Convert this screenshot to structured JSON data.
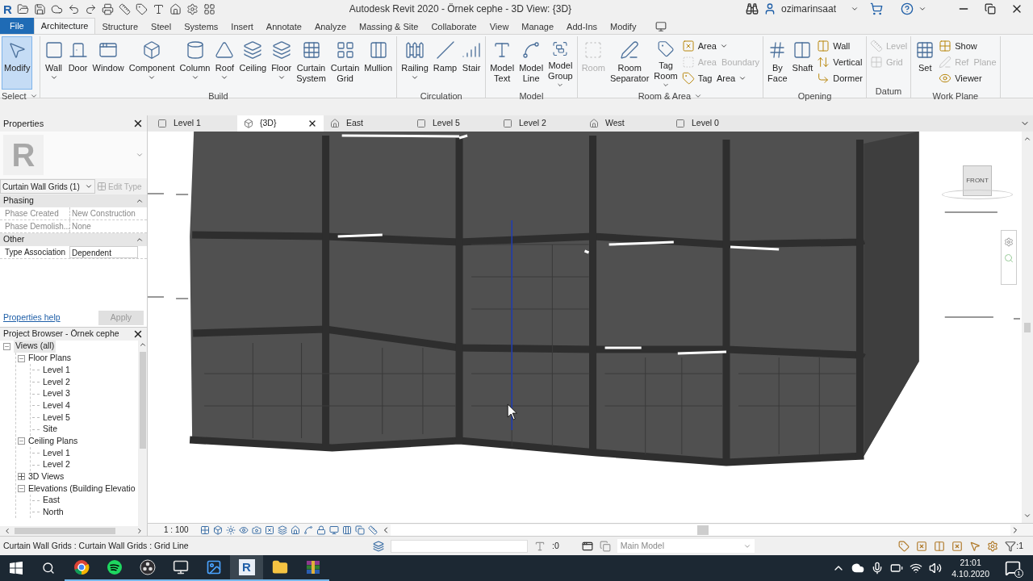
{
  "title_bar": {
    "logo": "R",
    "title": "Autodesk Revit 2020 - Örnek cephe - 3D View: {3D}",
    "user": "ozimarinsaat"
  },
  "ribbon_tabs": [
    {
      "label": "File",
      "kind": "file",
      "selected": false
    },
    {
      "label": "Architecture",
      "kind": "tab",
      "selected": true
    },
    {
      "label": "Structure",
      "kind": "tab",
      "selected": false
    },
    {
      "label": "Steel",
      "kind": "tab",
      "selected": false
    },
    {
      "label": "Systems",
      "kind": "tab",
      "selected": false
    },
    {
      "label": "Insert",
      "kind": "tab",
      "selected": false
    },
    {
      "label": "Annotate",
      "kind": "tab",
      "selected": false
    },
    {
      "label": "Analyze",
      "kind": "tab",
      "selected": false
    },
    {
      "label": "Massing & Site",
      "kind": "tab",
      "selected": false
    },
    {
      "label": "Collaborate",
      "kind": "tab",
      "selected": false
    },
    {
      "label": "View",
      "kind": "tab",
      "selected": false
    },
    {
      "label": "Manage",
      "kind": "tab",
      "selected": false
    },
    {
      "label": "Add-Ins",
      "kind": "tab",
      "selected": false
    },
    {
      "label": "Modify",
      "kind": "tab",
      "selected": false
    }
  ],
  "ribbon_panels": [
    {
      "title": "Select",
      "dropdown": true,
      "tools": [
        {
          "label": "Modify",
          "kind": "large",
          "selected": true,
          "dropdown": false,
          "disabled": false
        }
      ]
    },
    {
      "title": "Build",
      "dropdown": false,
      "tools": [
        {
          "label": "Wall",
          "kind": "large",
          "selected": false,
          "dropdown": true,
          "disabled": false
        },
        {
          "label": "Door",
          "kind": "large",
          "selected": false,
          "dropdown": false,
          "disabled": false
        },
        {
          "label": "Window",
          "kind": "large",
          "selected": false,
          "dropdown": false,
          "disabled": false
        },
        {
          "label": "Component",
          "kind": "large",
          "selected": false,
          "dropdown": true,
          "disabled": false
        },
        {
          "label": "Column",
          "kind": "large",
          "selected": false,
          "dropdown": true,
          "disabled": false
        },
        {
          "label": "Roof",
          "kind": "large",
          "selected": false,
          "dropdown": true,
          "disabled": false
        },
        {
          "label": "Ceiling",
          "kind": "large",
          "selected": false,
          "dropdown": false,
          "disabled": false
        },
        {
          "label": "Floor",
          "kind": "large",
          "selected": false,
          "dropdown": true,
          "disabled": false
        },
        {
          "label": "Curtain System",
          "kind": "large",
          "selected": false,
          "dropdown": false,
          "disabled": false
        },
        {
          "label": "Curtain Grid",
          "kind": "large",
          "selected": false,
          "dropdown": false,
          "disabled": false
        },
        {
          "label": "Mullion",
          "kind": "large",
          "selected": false,
          "dropdown": false,
          "disabled": false
        }
      ]
    },
    {
      "title": "Circulation",
      "dropdown": false,
      "tools": [
        {
          "label": "Railing",
          "kind": "large",
          "selected": false,
          "dropdown": true,
          "disabled": false
        },
        {
          "label": "Ramp",
          "kind": "large",
          "selected": false,
          "dropdown": false,
          "disabled": false
        },
        {
          "label": "Stair",
          "kind": "large",
          "selected": false,
          "dropdown": false,
          "disabled": false
        }
      ]
    },
    {
      "title": "Model",
      "dropdown": false,
      "tools": [
        {
          "label": "Model Text",
          "kind": "large",
          "selected": false,
          "dropdown": false,
          "disabled": false
        },
        {
          "label": "Model Line",
          "kind": "large",
          "selected": false,
          "dropdown": false,
          "disabled": false
        },
        {
          "label": "Model Group",
          "kind": "large",
          "selected": false,
          "dropdown": true,
          "disabled": false
        }
      ]
    },
    {
      "title": "Room & Area",
      "dropdown": true,
      "tools": [
        {
          "label": "Room",
          "kind": "large",
          "selected": false,
          "dropdown": false,
          "disabled": true
        },
        {
          "label": "Room Separator",
          "kind": "large",
          "selected": false,
          "dropdown": false,
          "disabled": false
        },
        {
          "label": "Tag Room",
          "kind": "large",
          "selected": false,
          "dropdown": true,
          "disabled": false
        },
        {
          "label": "Area",
          "kind": "small",
          "selected": false,
          "dropdown": true,
          "disabled": false
        },
        {
          "label": "Area  Boundary",
          "kind": "small",
          "selected": false,
          "dropdown": false,
          "disabled": true
        },
        {
          "label": "Tag  Area",
          "kind": "small",
          "selected": false,
          "dropdown": true,
          "disabled": false
        }
      ]
    },
    {
      "title": "Opening",
      "dropdown": false,
      "tools": [
        {
          "label": "By Face",
          "kind": "large",
          "selected": false,
          "dropdown": false,
          "disabled": false
        },
        {
          "label": "Shaft",
          "kind": "large",
          "selected": false,
          "dropdown": false,
          "disabled": false
        },
        {
          "label": "Wall",
          "kind": "small",
          "selected": false,
          "dropdown": false,
          "disabled": false
        },
        {
          "label": "Vertical",
          "kind": "small",
          "selected": false,
          "dropdown": false,
          "disabled": false
        },
        {
          "label": "Dormer",
          "kind": "small",
          "selected": false,
          "dropdown": false,
          "disabled": false
        }
      ]
    },
    {
      "title": "Datum",
      "dropdown": false,
      "tools": [
        {
          "label": "Level",
          "kind": "small",
          "selected": false,
          "dropdown": false,
          "disabled": true
        },
        {
          "label": "Grid",
          "kind": "small",
          "selected": false,
          "dropdown": false,
          "disabled": true
        }
      ]
    },
    {
      "title": "Work Plane",
      "dropdown": false,
      "tools": [
        {
          "label": "Set",
          "kind": "large",
          "selected": false,
          "dropdown": false,
          "disabled": false
        },
        {
          "label": "Show",
          "kind": "small",
          "selected": false,
          "dropdown": false,
          "disabled": false
        },
        {
          "label": "Ref  Plane",
          "kind": "small",
          "selected": false,
          "dropdown": false,
          "disabled": true
        },
        {
          "label": "Viewer",
          "kind": "small",
          "selected": false,
          "dropdown": false,
          "disabled": false
        }
      ]
    }
  ],
  "properties": {
    "title": "Properties",
    "type_glyph": "R",
    "type_selector": "Curtain Wall Grids (1)",
    "edit_type": {
      "label": "Edit Type",
      "disabled": true
    },
    "groups": [
      {
        "name": "Phasing",
        "rows": [
          {
            "label": "Phase Created",
            "value": "New Construction",
            "disabled": true
          },
          {
            "label": "Phase Demolish...",
            "value": "None",
            "disabled": true
          }
        ]
      },
      {
        "name": "Other",
        "rows": [
          {
            "label": "Type Association",
            "value": "Dependent",
            "disabled": false
          }
        ]
      }
    ],
    "help_link": "Properties help",
    "apply": {
      "label": "Apply",
      "disabled": true
    }
  },
  "project_browser": {
    "title": "Project Browser - Örnek cephe",
    "tree": [
      {
        "label": "Views (all)",
        "expanded": true,
        "children": [
          {
            "label": "Floor Plans",
            "expanded": true,
            "children": [
              {
                "label": "Level 1"
              },
              {
                "label": "Level 2"
              },
              {
                "label": "Level 3"
              },
              {
                "label": "Level 4"
              },
              {
                "label": "Level 5"
              },
              {
                "label": "Site"
              }
            ]
          },
          {
            "label": "Ceiling Plans",
            "expanded": true,
            "children": [
              {
                "label": "Level 1"
              },
              {
                "label": "Level 2"
              }
            ]
          },
          {
            "label": "3D Views",
            "expanded": false
          },
          {
            "label": "Elevations (Building Elevatio",
            "expanded": true,
            "children": [
              {
                "label": "East"
              },
              {
                "label": "North"
              }
            ]
          }
        ]
      }
    ]
  },
  "view_tabs": [
    {
      "label": "Level 1",
      "kind": "plan",
      "selected": false
    },
    {
      "label": "{3D}",
      "kind": "perspective",
      "selected": true
    },
    {
      "label": "East",
      "kind": "elevation",
      "selected": false
    },
    {
      "label": "Level 5",
      "kind": "plan",
      "selected": false
    },
    {
      "label": "Level 2",
      "kind": "plan",
      "selected": false
    },
    {
      "label": "West",
      "kind": "elevation",
      "selected": false
    },
    {
      "label": "Level 0",
      "kind": "plan",
      "selected": false
    }
  ],
  "view_cube": {
    "face": "FRONT"
  },
  "view_control_bar": {
    "scale": "1 : 100"
  },
  "status_bar": {
    "text": "Curtain Wall Grids : Curtain Wall Grids : Grid Line",
    "workset_count": ":0",
    "model": "Main Model",
    "filter_count": ":1"
  },
  "taskbar": {
    "apps": [
      {
        "kind": "chrome",
        "selected": false
      },
      {
        "kind": "spotify",
        "selected": false
      },
      {
        "kind": "obs",
        "selected": false
      },
      {
        "kind": "monitor",
        "selected": false
      },
      {
        "kind": "photos",
        "selected": false
      },
      {
        "kind": "revit",
        "glyph": "R",
        "selected": true
      },
      {
        "kind": "explorer",
        "selected": false
      },
      {
        "kind": "archive",
        "selected": false
      }
    ],
    "time": "21:01",
    "date": "4.10.2020",
    "notifications": "1"
  }
}
